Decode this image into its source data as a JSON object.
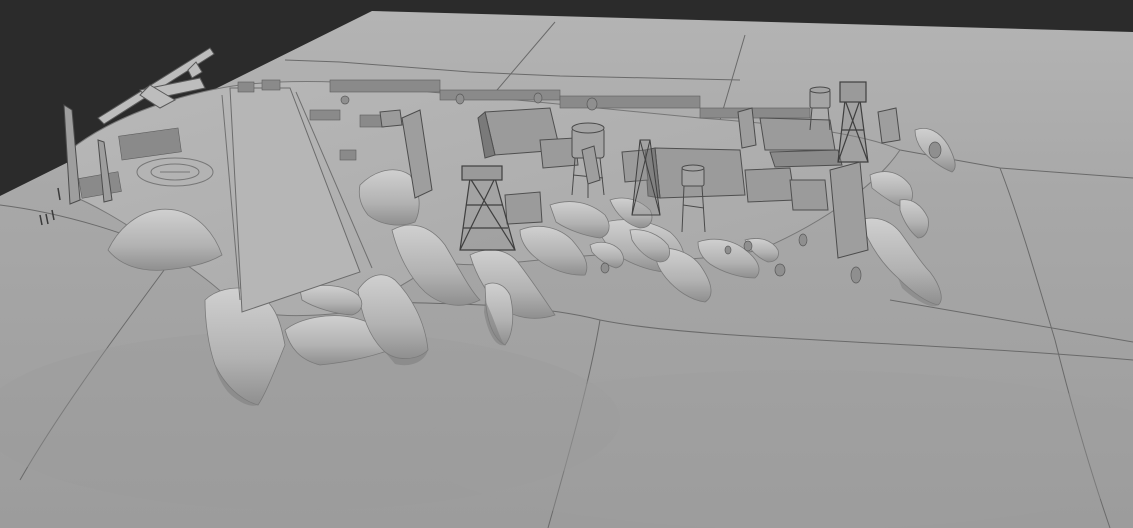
{
  "viewport": {
    "background_color": "#2b2b2b",
    "shading_mode": "solid",
    "object_color": "#a9a9a9",
    "scene_subject": "3d-terrain-model"
  }
}
